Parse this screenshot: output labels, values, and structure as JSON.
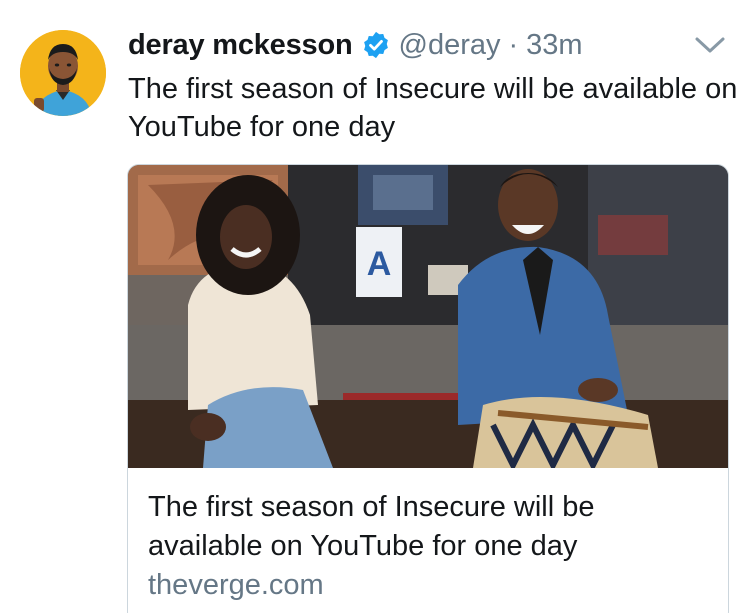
{
  "tweet": {
    "author": {
      "display_name": "deray mckesson",
      "verified_icon": "verified-badge-icon",
      "handle": "@deray",
      "separator": "·",
      "time": "33m"
    },
    "menu_icon": "chevron-down-icon",
    "text": "The first season of Insecure will be available on YouTube for one day",
    "card": {
      "title": "The first season of Insecure will be available on YouTube for one day",
      "domain": "theverge.com"
    }
  },
  "colors": {
    "primary_text": "#14171a",
    "secondary_text": "#657786",
    "verified_blue": "#1da1f2",
    "card_border": "#ccd6dd",
    "avatar_bg": "#f4b41a"
  }
}
